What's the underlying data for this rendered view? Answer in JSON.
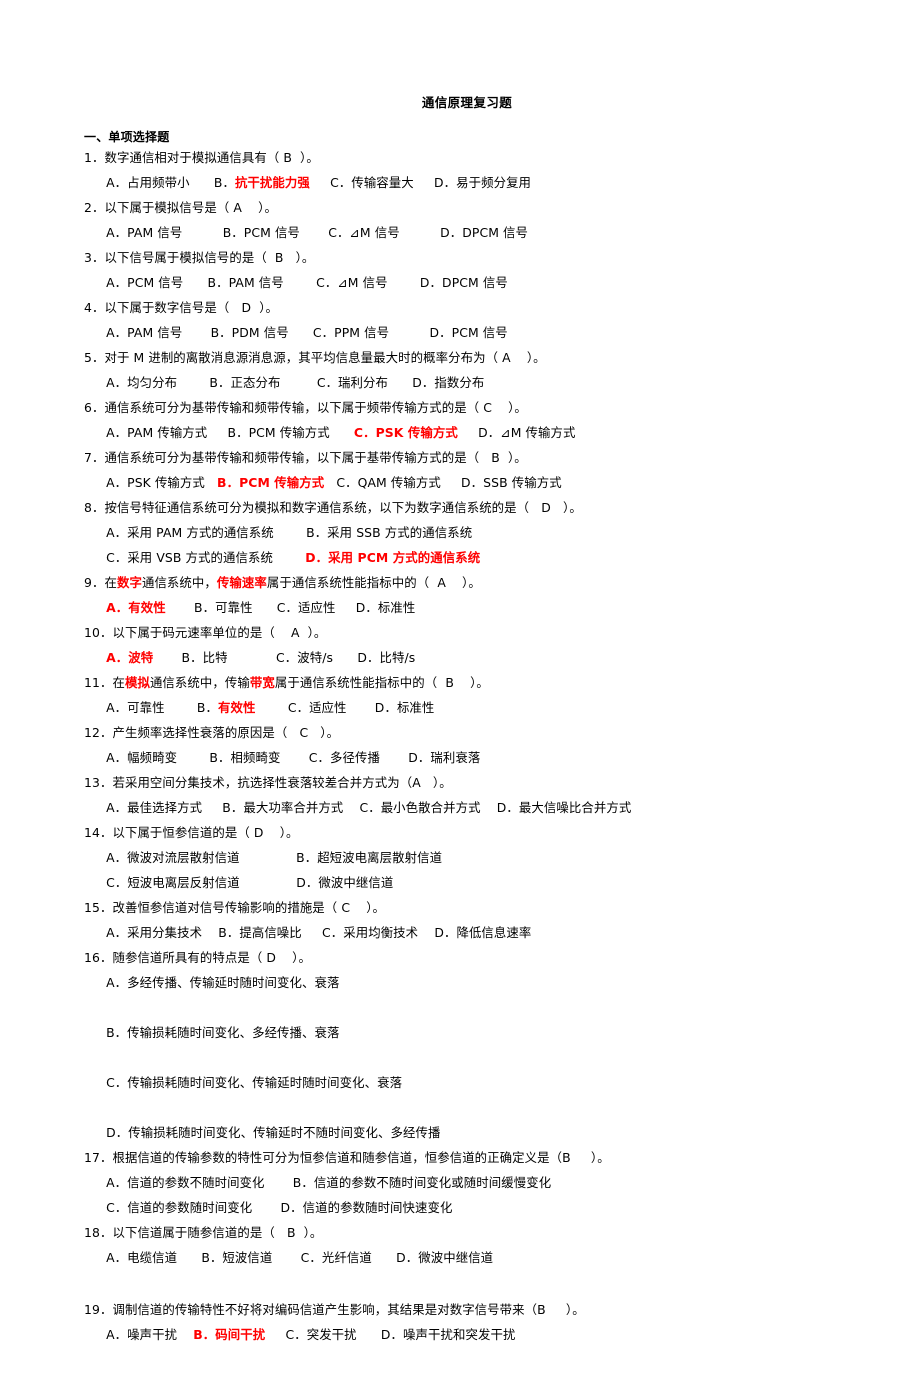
{
  "document": {
    "title": "通信原理复习题",
    "section_heading": "一、单项选择题",
    "accent_color": "#FF0000"
  },
  "questions": [
    {
      "id": "q1",
      "stem_plain": "1．数字通信相对于模拟通信具有（ B  ）。",
      "stem_parts": [
        {
          "t": "1．数字通信相对于模拟通信具有（ B  ）。",
          "red": false
        }
      ],
      "options_parts": [
        {
          "t": "  A．占用频带小",
          "red": false
        },
        {
          "t": "      B．",
          "red": false
        },
        {
          "t": "抗干扰能力强",
          "red": true
        },
        {
          "t": "     C．传输容量大     D．易于频分复用",
          "red": false
        }
      ]
    },
    {
      "id": "q2",
      "stem_parts": [
        {
          "t": "2．以下属于模拟信号是（ A    ）。",
          "red": false
        }
      ],
      "options_parts": [
        {
          "t": "  A．PAM 信号          B．PCM 信号       C．⊿M 信号          D．DPCM 信号",
          "red": false
        }
      ]
    },
    {
      "id": "q3",
      "stem_parts": [
        {
          "t": "3．以下信号属于模拟信号的是（  B   ）。",
          "red": false
        }
      ],
      "options_parts": [
        {
          "t": "  A．PCM 信号      B．PAM 信号        C．⊿M 信号        D．DPCM 信号",
          "red": false
        }
      ]
    },
    {
      "id": "q4",
      "stem_parts": [
        {
          "t": "4．以下属于数字信号是（   D  ）。",
          "red": false
        }
      ],
      "options_parts": [
        {
          "t": "  A．PAM 信号       B．PDM 信号      C．PPM 信号          D．PCM 信号",
          "red": false
        }
      ]
    },
    {
      "id": "q5",
      "stem_parts": [
        {
          "t": "5．对于 M 进制的离散消息源消息源，其平均信息量最大时的概率分布为（ A    ）。",
          "red": false
        }
      ],
      "options_parts": [
        {
          "t": "  A．均匀分布        B．正态分布         C．瑞利分布      D．指数分布",
          "red": false
        }
      ]
    },
    {
      "id": "q6",
      "stem_parts": [
        {
          "t": "6．通信系统可分为基带传输和频带传输，以下属于频带传输方式的是（ C    ）。",
          "red": false
        }
      ],
      "options_parts": [
        {
          "t": "  A．PAM 传输方式     B．PCM 传输方式      ",
          "red": false
        },
        {
          "t": "C．PSK 传输方式",
          "red": true
        },
        {
          "t": "     D．⊿M 传输方式",
          "red": false
        }
      ]
    },
    {
      "id": "q7",
      "stem_parts": [
        {
          "t": "7．通信系统可分为基带传输和频带传输，以下属于基带传输方式的是（   B  ）。",
          "red": false
        }
      ],
      "options_parts": [
        {
          "t": "  A．PSK 传输方式   ",
          "red": false
        },
        {
          "t": "B．PCM 传输方式",
          "red": true
        },
        {
          "t": "   C．QAM 传输方式     D．SSB 传输方式",
          "red": false
        }
      ]
    },
    {
      "id": "q8",
      "stem_parts": [
        {
          "t": "8．按信号特征通信系统可分为模拟和数字通信系统，以下为数字通信系统的是（   D   ）。",
          "red": false
        }
      ],
      "options_parts": [
        {
          "t": "  A．采用 PAM 方式的通信系统        B．采用 SSB 方式的通信系统\n  C．采用 VSB 方式的通信系统        ",
          "red": false
        },
        {
          "t": "D．采用 PCM 方式的通信系统",
          "red": true
        }
      ]
    },
    {
      "id": "q9",
      "stem_parts": [
        {
          "t": "9．在",
          "red": false
        },
        {
          "t": "数字",
          "red": true
        },
        {
          "t": "通信系统中，",
          "red": false
        },
        {
          "t": "传输速率",
          "red": true
        },
        {
          "t": "属于通信系统性能指标中的（  A    ）。",
          "red": false
        }
      ],
      "options_parts": [
        {
          "t": "  ",
          "red": false
        },
        {
          "t": "A．有效性",
          "red": true
        },
        {
          "t": "       B．可靠性      C．适应性     D．标准性",
          "red": false
        }
      ]
    },
    {
      "id": "q10",
      "stem_parts": [
        {
          "t": "10．以下属于码元速率单位的是（    A  ）。",
          "red": false
        }
      ],
      "options_parts": [
        {
          "t": "  ",
          "red": false
        },
        {
          "t": "A．波特",
          "red": true
        },
        {
          "t": "       B．比特            C．波特/s      D．比特/s",
          "red": false
        }
      ]
    },
    {
      "id": "q11",
      "stem_parts": [
        {
          "t": "11．在",
          "red": false
        },
        {
          "t": "模拟",
          "red": true
        },
        {
          "t": "通信系统中，传输",
          "red": false
        },
        {
          "t": "带宽",
          "red": true
        },
        {
          "t": "属于通信系统性能指标中的（  B    ）。",
          "red": false
        }
      ],
      "options_parts": [
        {
          "t": "  A．可靠性        B．",
          "red": false
        },
        {
          "t": "有效性",
          "red": true
        },
        {
          "t": "        C．适应性       D．标准性",
          "red": false
        }
      ]
    },
    {
      "id": "q12",
      "stem_parts": [
        {
          "t": "12．产生频率选择性衰落的原因是（   C   ）。",
          "red": false
        }
      ],
      "options_parts": [
        {
          "t": "  A．幅频畸变        B．相频畸变       C．多径传播       D．瑞利衰落",
          "red": false
        }
      ]
    },
    {
      "id": "q13",
      "stem_parts": [
        {
          "t": "13．若采用空间分集技术，抗选择性衰落较差合并方式为（A   ）。",
          "red": false
        }
      ],
      "options_parts": [
        {
          "t": "  A．最佳选择方式     B．最大功率合并方式    C．最小色散合并方式    D．最大信噪比合并方式",
          "red": false
        }
      ]
    },
    {
      "id": "q14",
      "stem_parts": [
        {
          "t": "14．以下属于恒参信道的是（ D    ）。",
          "red": false
        }
      ],
      "options_parts": [
        {
          "t": "  A．微波对流层散射信道              B．超短波电离层散射信道\n  C．短波电离层反射信道              D．微波中继信道",
          "red": false
        }
      ]
    },
    {
      "id": "q15",
      "stem_parts": [
        {
          "t": "15．改善恒参信道对信号传输影响的措施是（ C    ）。",
          "red": false
        }
      ],
      "options_parts": [
        {
          "t": "  A．采用分集技术    B．提高信噪比     C．采用均衡技术    D．降低信息速率",
          "red": false
        }
      ]
    },
    {
      "id": "q16",
      "stem_parts": [
        {
          "t": "16．随参信道所具有的特点是（ D    ）。",
          "red": false
        }
      ],
      "options_parts": [
        {
          "t": "  A．多经传播、传输延时随时间变化、衰落\n\n  B．传输损耗随时间变化、多经传播、衰落\n\n  C．传输损耗随时间变化、传输延时随时间变化、衰落\n\n  D．传输损耗随时间变化、传输延时不随时间变化、多经传播",
          "red": false
        }
      ]
    },
    {
      "id": "q17",
      "stem_parts": [
        {
          "t": "17．根据信道的传输参数的特性可分为恒参信道和随参信道，恒参信道的正确定义是（B     ）。",
          "red": false
        }
      ],
      "options_parts": [
        {
          "t": "  A．信道的参数不随时间变化       B．信道的参数不随时间变化或随时间缓慢变化\n  C．信道的参数随时间变化       D．信道的参数随时间快速变化",
          "red": false
        }
      ]
    },
    {
      "id": "q18",
      "stem_parts": [
        {
          "t": "18．以下信道属于随参信道的是（   B  ）。",
          "red": false
        }
      ],
      "options_parts": [
        {
          "t": "  A．电缆信道      B．短波信道       C．光纤信道      D．微波中继信道",
          "red": false
        }
      ]
    },
    {
      "id": "q19",
      "spacer_before": true,
      "stem_parts": [
        {
          "t": "19．调制信道的传输特性不好将对编码信道产生影响，其结果是对数字信号带来（B     ）。",
          "red": false
        }
      ],
      "options_parts": [
        {
          "t": "  A．噪声干扰    ",
          "red": false
        },
        {
          "t": "B．码间干扰",
          "red": true
        },
        {
          "t": "     C．突发干扰      D．噪声干扰和突发干扰",
          "red": false
        }
      ]
    }
  ]
}
